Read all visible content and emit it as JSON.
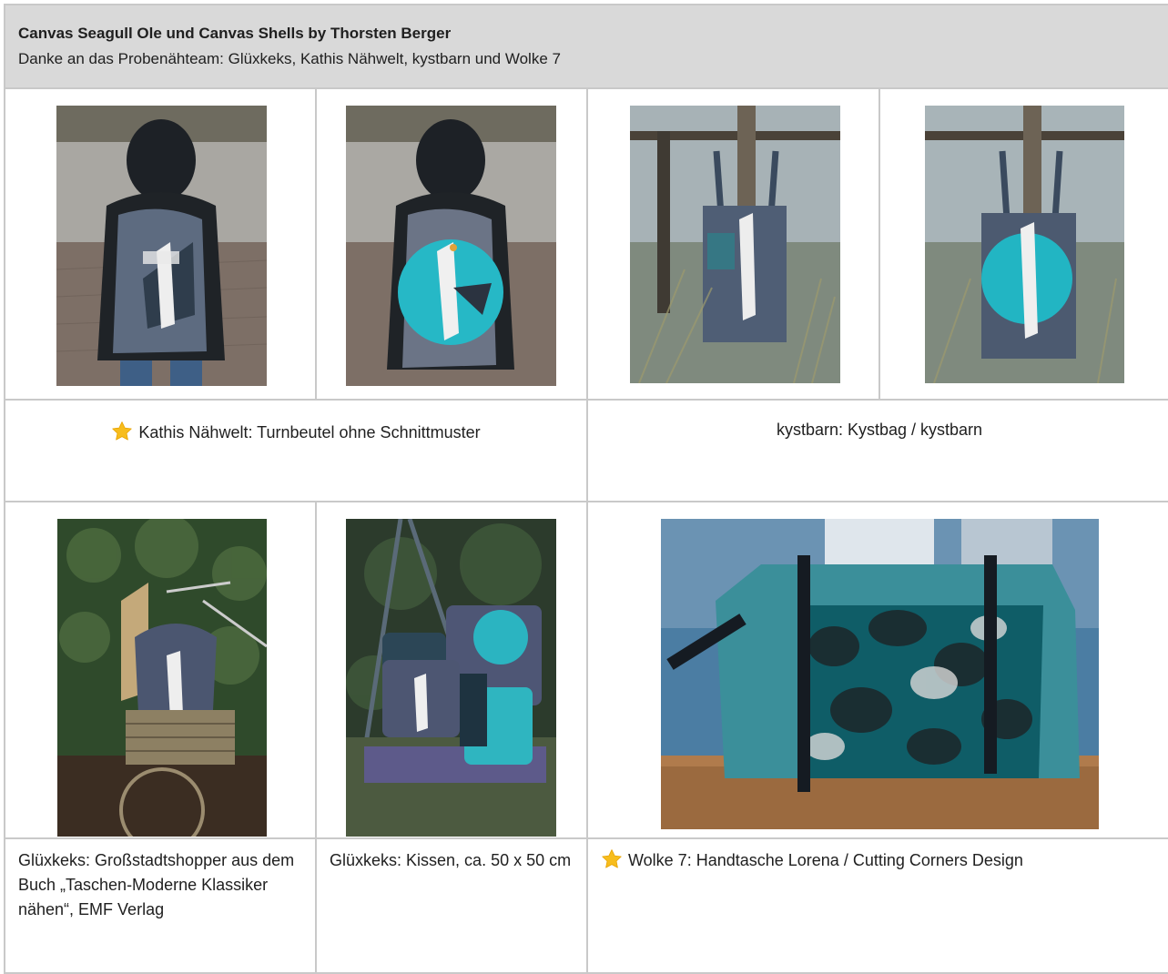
{
  "header": {
    "title": "Canvas Seagull Ole und Canvas Shells by Thorsten Berger",
    "subtitle": "Danke an das Probenähteam: Glüxkeks, Kathis Nähwelt, kystbarn und Wolke 7"
  },
  "row1_photos": [
    {
      "icon": "backpack-boy-photo",
      "variant": "grey-seagull"
    },
    {
      "icon": "backpack-boy-photo",
      "variant": "turquoise-circle"
    },
    {
      "icon": "tote-bag-fence-photo",
      "variant": "grey-seagull"
    },
    {
      "icon": "tote-bag-fence-photo",
      "variant": "turquoise-circle"
    }
  ],
  "row1_captions": {
    "left": "Kathis Nähwelt: Turnbeutel ohne Schnittmuster",
    "left_starred": true,
    "right": "kystbarn: Kystbag / kystbarn",
    "right_starred": false
  },
  "row2_photos": [
    {
      "icon": "bicycle-basket-bag-photo"
    },
    {
      "icon": "pillows-swing-photo"
    },
    {
      "icon": "handbag-table-photo"
    }
  ],
  "row2_captions": {
    "c1": "Glüxkeks: Großstadtshopper aus dem Buch „Taschen-Moderne Klassiker nähen“, EMF Verlag",
    "c2": "Glüxkeks: Kissen, ca. 50 x 50 cm",
    "c3": "Wolke 7: Handtasche Lorena / Cutting Corners Design",
    "c3_starred": true
  },
  "colors": {
    "header_bg": "#d9d9d9",
    "border": "#c9c9c9",
    "star": "#f5b800",
    "turquoise": "#2bb3c0",
    "denim": "#4e5e74"
  }
}
